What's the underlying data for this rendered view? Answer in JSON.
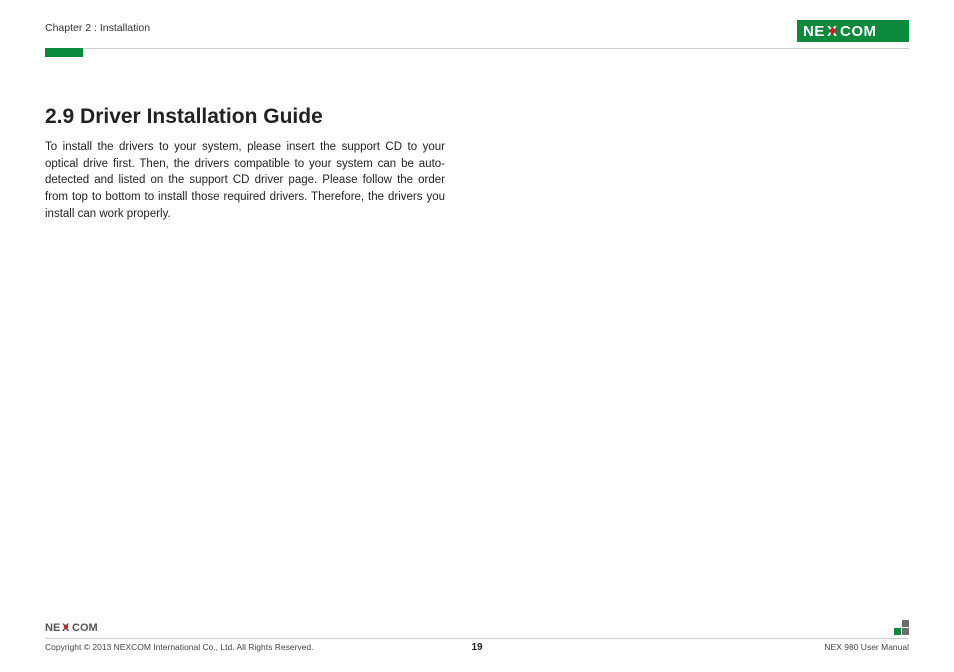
{
  "header": {
    "chapter": "Chapter 2 : Installation",
    "brand": "NEXCOM"
  },
  "content": {
    "heading": "2.9 Driver Installation Guide",
    "paragraph": "To install the drivers to your system, please insert the support CD to your optical drive first. Then, the drivers compatible to your system can be auto-detected and listed on the support CD driver page. Please follow the order from top to bottom to install those required drivers. Therefore, the drivers you install can work properly."
  },
  "footer": {
    "copyright": "Copyright © 2013 NEXCOM International Co., Ltd. All Rights Reserved.",
    "page_number": "19",
    "doc_title": "NEX 980 User Manual",
    "brand": "NEXCOM"
  }
}
